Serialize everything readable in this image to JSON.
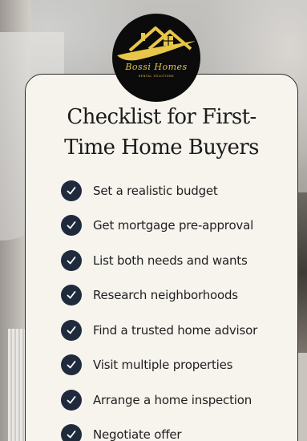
{
  "logo": {
    "script_text": "Bossi Homes",
    "sub_text": "RENTAL SOLUTIONS"
  },
  "title": {
    "line1": "Checklist for First-",
    "line2": "Time Home Buyers"
  },
  "checklist": {
    "items": [
      {
        "label": "Set a realistic budget",
        "icon": "check-icon"
      },
      {
        "label": "Get mortgage pre-approval",
        "icon": "check-icon"
      },
      {
        "label": "List both needs and wants",
        "icon": "check-icon"
      },
      {
        "label": "Research neighborhoods",
        "icon": "check-icon"
      },
      {
        "label": "Find a trusted home advisor",
        "icon": "check-icon"
      },
      {
        "label": "Visit multiple properties",
        "icon": "check-icon"
      },
      {
        "label": "Arrange a home inspection",
        "icon": "check-icon"
      },
      {
        "label": "Negotiate offer",
        "icon": "check-icon"
      }
    ]
  },
  "colors": {
    "card_background": "#f7f4ee",
    "check_circle": "#1f2b3d",
    "logo_background": "#0b0b0b",
    "logo_gold": "#e7c64a"
  }
}
